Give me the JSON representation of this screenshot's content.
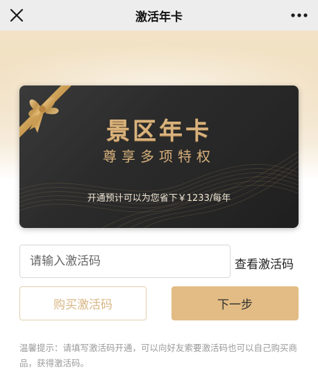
{
  "navbar": {
    "title": "激活年卡",
    "close_icon": "close-icon",
    "more_icon": "more-icon"
  },
  "card": {
    "title": "景区年卡",
    "subtitle": "尊享多项特权",
    "save_text": "开通预计可以为您省下￥1233/每年",
    "ribbon_icon": "gift-ribbon-icon"
  },
  "form": {
    "code_input_value": "",
    "code_input_placeholder": "请输入激活码",
    "view_code_label": "查看激活码",
    "buy_button_label": "购买激活码",
    "next_button_label": "下一步"
  },
  "tip": {
    "text": "温馨提示：请填写激活码开通，可以向好友索要激活码也可以自己购买商品，获得激活码。"
  },
  "colors": {
    "gold_accent": "#e2bc84",
    "gold_text": "#d9b27c",
    "card_dark": "#2b2b2b",
    "navbar_bg": "#ededed"
  }
}
